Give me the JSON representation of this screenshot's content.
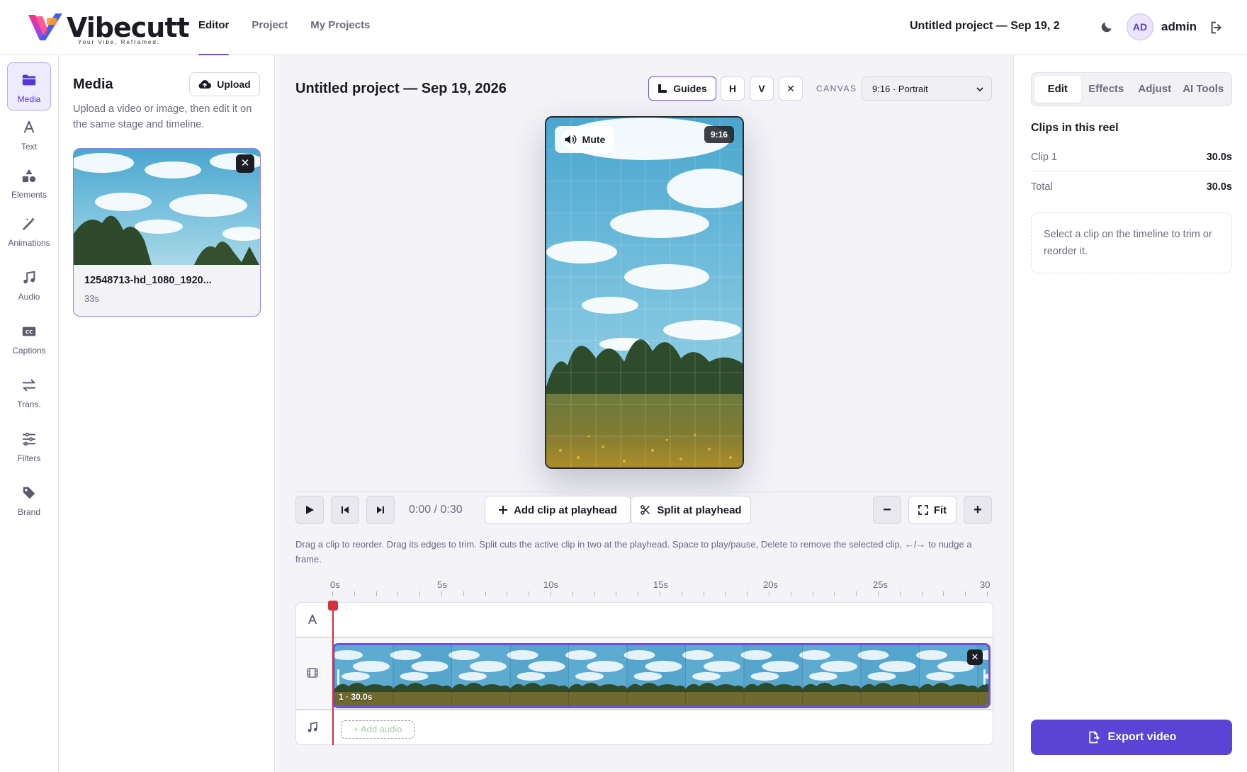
{
  "app": {
    "logo_text": "Vibecutt",
    "tagline": "Your Vibe, Reframed.",
    "nav": [
      {
        "label": "Editor",
        "active": true
      },
      {
        "label": "Project",
        "active": false
      },
      {
        "label": "My Projects",
        "active": false
      }
    ],
    "project_title": "Untitled project — Sep 19, 2",
    "user": {
      "initials": "AD",
      "name": "admin"
    },
    "accent": "#6a4fe0"
  },
  "rail": [
    {
      "label": "Media",
      "icon": "folder-icon",
      "active": true
    },
    {
      "label": "Text",
      "icon": "text-icon",
      "active": false
    },
    {
      "label": "Elements",
      "icon": "shapes-icon",
      "active": false
    },
    {
      "label": "Animations",
      "icon": "magic-wand-icon",
      "active": false
    },
    {
      "label": "Audio",
      "icon": "music-note-icon",
      "active": false
    },
    {
      "label": "Captions",
      "icon": "cc-icon",
      "active": false
    },
    {
      "label": "Trans.",
      "icon": "swap-arrows-icon",
      "active": false
    },
    {
      "label": "Filters",
      "icon": "sliders-icon",
      "active": false
    },
    {
      "label": "Brand",
      "icon": "tag-icon",
      "active": false
    }
  ],
  "media": {
    "title": "Media",
    "upload_label": "Upload",
    "description": "Upload a video or image, then edit it on the same stage and timeline.",
    "item": {
      "name": "12548713-hd_1080_1920...",
      "duration": "33s",
      "close": "✕"
    }
  },
  "stage": {
    "title": "Untitled project — Sep 19, 2026",
    "guides_label": "Guides",
    "h_label": "H",
    "v_label": "V",
    "x_label": "✕",
    "canvas_label": "CANVAS",
    "canvas_value": "9:16 · Portrait",
    "preview": {
      "mute_label": "Mute",
      "ratio_badge": "9:16"
    }
  },
  "controls": {
    "time": "0:00 / 0:30",
    "add_clip_label": "Add clip at playhead",
    "split_label": "Split at playhead",
    "zoom_out": "−",
    "fit_label": "Fit",
    "zoom_in": "+",
    "hint": "Drag a clip to reorder. Drag its edges to trim. Split cuts the active clip in two at the playhead. Space to play/pause, Delete to remove the selected clip, ←/→ to nudge a frame."
  },
  "timeline": {
    "ruler": [
      "0s",
      "5s",
      "10s",
      "15s",
      "20s",
      "25s",
      "30"
    ],
    "clip": {
      "label": "1 · 30.0s",
      "close": "✕"
    },
    "add_audio": "+ Add audio",
    "playhead_time": 0
  },
  "right": {
    "tabs": [
      {
        "label": "Edit",
        "active": true
      },
      {
        "label": "Effects",
        "active": false
      },
      {
        "label": "Adjust",
        "active": false
      },
      {
        "label": "AI Tools",
        "active": false
      }
    ],
    "title": "Clips in this reel",
    "rows": [
      {
        "key": "Clip 1",
        "value": "30.0s"
      },
      {
        "key": "Total",
        "value": "30.0s"
      }
    ],
    "note": "Select a clip on the timeline to trim or reorder it.",
    "export_label": "Export video"
  }
}
